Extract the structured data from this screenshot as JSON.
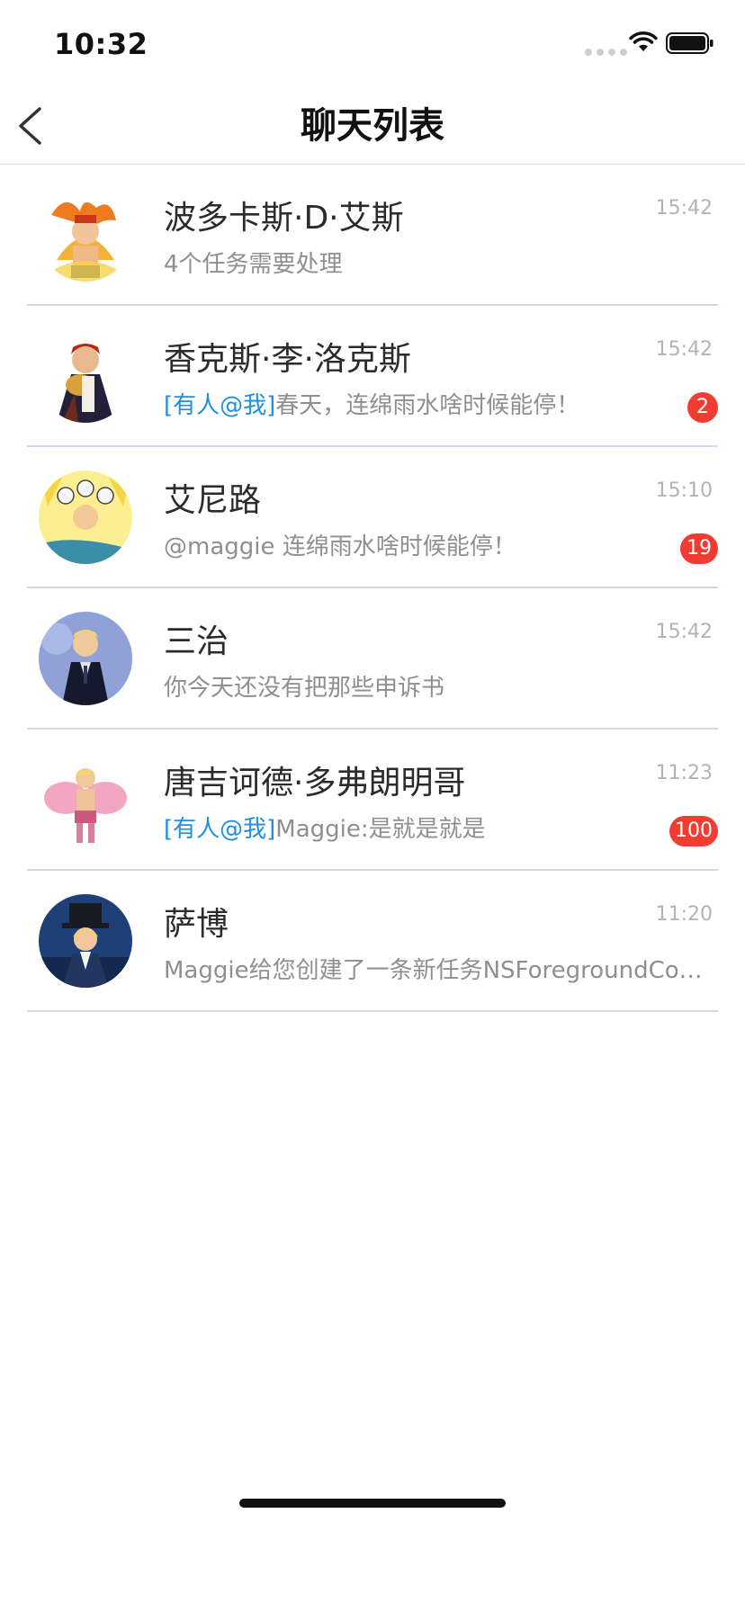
{
  "status_bar": {
    "time": "10:32"
  },
  "nav": {
    "title": "聊天列表",
    "back_icon": "chevron-left-icon"
  },
  "chats": [
    {
      "name": "波多卡斯·D·艾斯",
      "mention": "",
      "preview": "4个任务需要处理",
      "time": "15:42",
      "unread": ""
    },
    {
      "name": "香克斯·李·洛克斯",
      "mention": "[有人@我]",
      "preview": "春天，连绵雨水啥时候能停！",
      "time": "15:42",
      "unread": "2"
    },
    {
      "name": "艾尼路",
      "mention": "",
      "preview": "@maggie 连绵雨水啥时候能停！",
      "time": "15:10",
      "unread": "19"
    },
    {
      "name": "三治",
      "mention": "",
      "preview": "你今天还没有把那些申诉书",
      "time": "15:42",
      "unread": ""
    },
    {
      "name": "唐吉诃德·多弗朗明哥",
      "mention": "[有人@我]",
      "preview": "Maggie:是就是就是",
      "time": "11:23",
      "unread": "100"
    },
    {
      "name": "萨博",
      "mention": "",
      "preview": "Maggie给您创建了一条新任务NSForegroundColor",
      "time": "11:20",
      "unread": ""
    }
  ],
  "colors": {
    "mention": "#1e8fe1",
    "badge": "#f23c32",
    "separator": "#d4d6ea",
    "preview_text": "#8f8f8f"
  }
}
